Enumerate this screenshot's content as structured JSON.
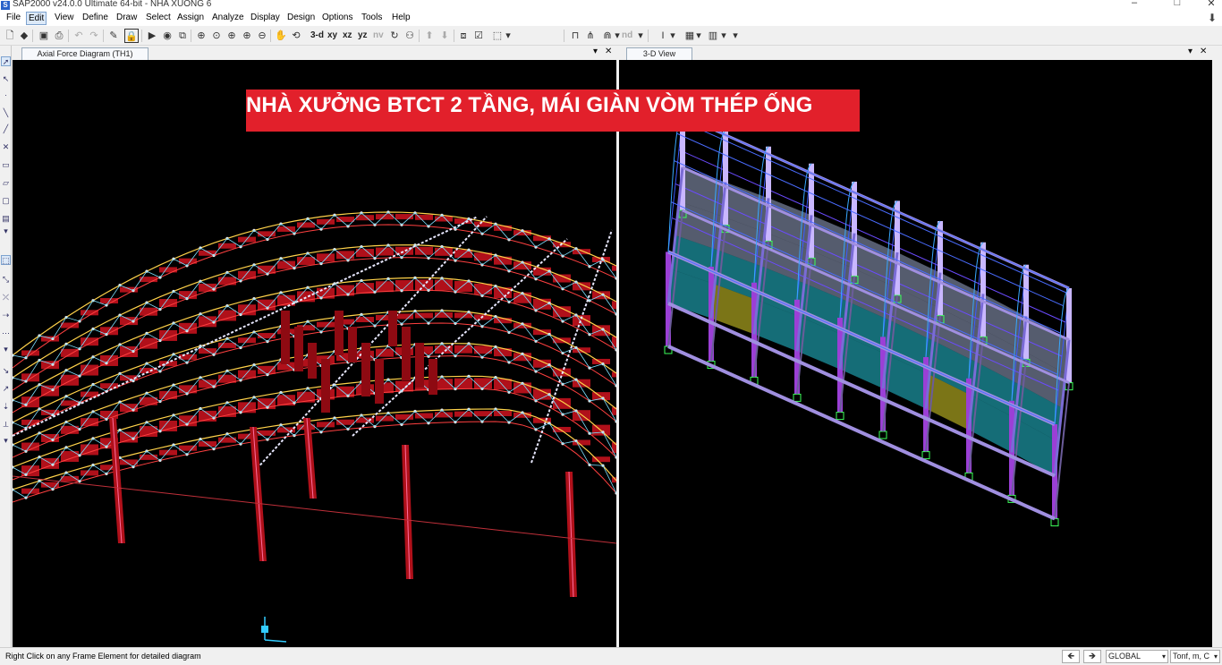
{
  "window": {
    "title": "SAP2000 v24.0.0 Ultimate 64-bit - NHA XUONG 6",
    "app_icon": "S",
    "minimize": "–",
    "maximize": "□",
    "close": "✕",
    "download": "⬇"
  },
  "menu": [
    "File",
    "Edit",
    "View",
    "Define",
    "Draw",
    "Select",
    "Assign",
    "Analyze",
    "Display",
    "Design",
    "Options",
    "Tools",
    "Help"
  ],
  "menu_active": "Edit",
  "toolbar": {
    "view_3d": "3-d",
    "view_xy": "xy",
    "view_xz": "xz",
    "view_yz": "yz",
    "view_nv": "nv",
    "nd": "nd"
  },
  "left_panel": {
    "tab_label": "Axial Force Diagram  (TH1)",
    "dropdown": "▾",
    "close": "✕"
  },
  "right_panel": {
    "tab_label": "3-D View",
    "dropdown": "▾",
    "close": "✕"
  },
  "banner": {
    "text": "NHÀ XƯỞNG BTCT 2 TẦNG, MÁI GIÀN VÒM THÉP ỐNG",
    "bg_color": "#e2202b"
  },
  "status": {
    "message": "Right Click on any Frame Element for detailed diagram",
    "coord_system": "GLOBAL",
    "units": "Tonf, m, C"
  },
  "colors": {
    "viewport_bg": "#000000",
    "axial_force_fill": "#b0101a",
    "truss_white": "#e8e8e8",
    "beam_purple": "#9b3fd6",
    "slab_cyan": "#27c7d8",
    "slab_yellow": "#e0d62a"
  }
}
